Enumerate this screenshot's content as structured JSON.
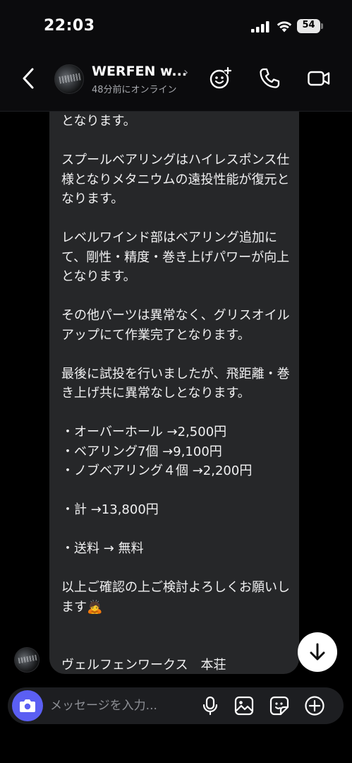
{
  "status_bar": {
    "time": "22:03",
    "battery_level": "54"
  },
  "header": {
    "contact_name": "WERFEN w...",
    "contact_status": "48分前にオンライン",
    "icons": [
      "back-chevron-icon",
      "avatar",
      "effects-icon",
      "phone-icon",
      "video-camera-icon"
    ]
  },
  "message": {
    "text": "となります。\n\nスプールベアリングはハイレスポンス仕様となりメタニウムの遠投性能が復元となります。\n\nレベルワインド部はベアリング追加にて、剛性・精度・巻き上げパワーが向上となります。\n\nその他パーツは異常なく、グリスオイルアップにて作業完了となります。\n\n最後に試投を行いましたが、飛距離・巻き上げ共に異常なしとなります。\n\n・オーバーホール →2,500円\n・ベアリング7個 →9,100円\n・ノブベアリング４個 →2,200円\n\n・計 →13,800円\n\n・送料 → 無料\n\n以上ご確認の上ご検討よろしくお願いします🙇\n\n\nヴェルフェンワークス　本荘"
  },
  "composer": {
    "placeholder": "メッセージを入力..."
  },
  "colors": {
    "accent": "#5b5ff3",
    "bubble": "#262729",
    "background": "#000000"
  }
}
